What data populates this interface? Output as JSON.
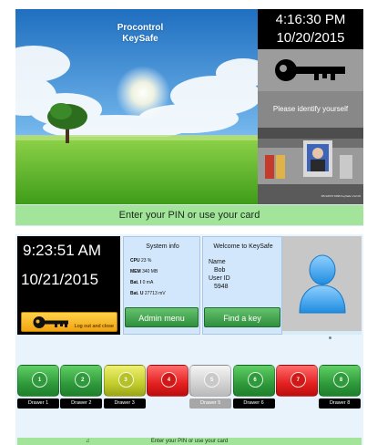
{
  "screen1": {
    "brand_line1": "Procontrol",
    "brand_line2": "KeySafe",
    "time": "4:16:30 PM",
    "date": "10/20/2015",
    "identify_prompt": "Please identify yourself",
    "camera_caption": "XB-S2570 MSB KeySafe V12.00",
    "pin_prompt": "Enter your PIN or use your card"
  },
  "screen2": {
    "time": "9:23:51 AM",
    "date": "10/21/2015",
    "logout_label": "Log out and close",
    "system_info": {
      "title": "System info",
      "stats": [
        {
          "key": "CPU",
          "value": "23 %"
        },
        {
          "key": "MEM",
          "value": "340 MB"
        },
        {
          "key": "Bat. I",
          "value": "0 mA"
        },
        {
          "key": "Bat. U",
          "value": "27713 mV"
        }
      ]
    },
    "welcome": {
      "title": "Welcome to KeySafe",
      "name_label": "Name",
      "name_value": "Bob",
      "userid_label": "User ID",
      "userid_value": "5948"
    },
    "admin_button": "Admin menu",
    "findkey_button": "Find a key",
    "drawers": [
      {
        "number": "1",
        "label": "Drawer 1",
        "status": "green"
      },
      {
        "number": "2",
        "label": "Drawer 2",
        "status": "green"
      },
      {
        "number": "3",
        "label": "Drawer 3",
        "status": "yellow"
      },
      {
        "number": "4",
        "label": "",
        "status": "red"
      },
      {
        "number": "5",
        "label": "Drawer 5",
        "status": "grey"
      },
      {
        "number": "6",
        "label": "Drawer 6",
        "status": "green"
      },
      {
        "number": "7",
        "label": "",
        "status": "red"
      },
      {
        "number": "8",
        "label": "Drawer 8",
        "status": "green"
      }
    ],
    "pin_prompt": "Enter your PIN or use your card"
  },
  "colors": {
    "pin_bar": "#a2e59a",
    "panel_blue": "#d2e7fb",
    "drawer_green": "#2f9a3b",
    "drawer_red": "#e42020",
    "drawer_yellow": "#c2cd2d",
    "drawer_grey": "#d2d2d2",
    "logout_orange": "#f3a40f"
  },
  "icons": [
    "key-icon",
    "person-avatar-icon",
    "camera-feed",
    "tree-landscape"
  ]
}
